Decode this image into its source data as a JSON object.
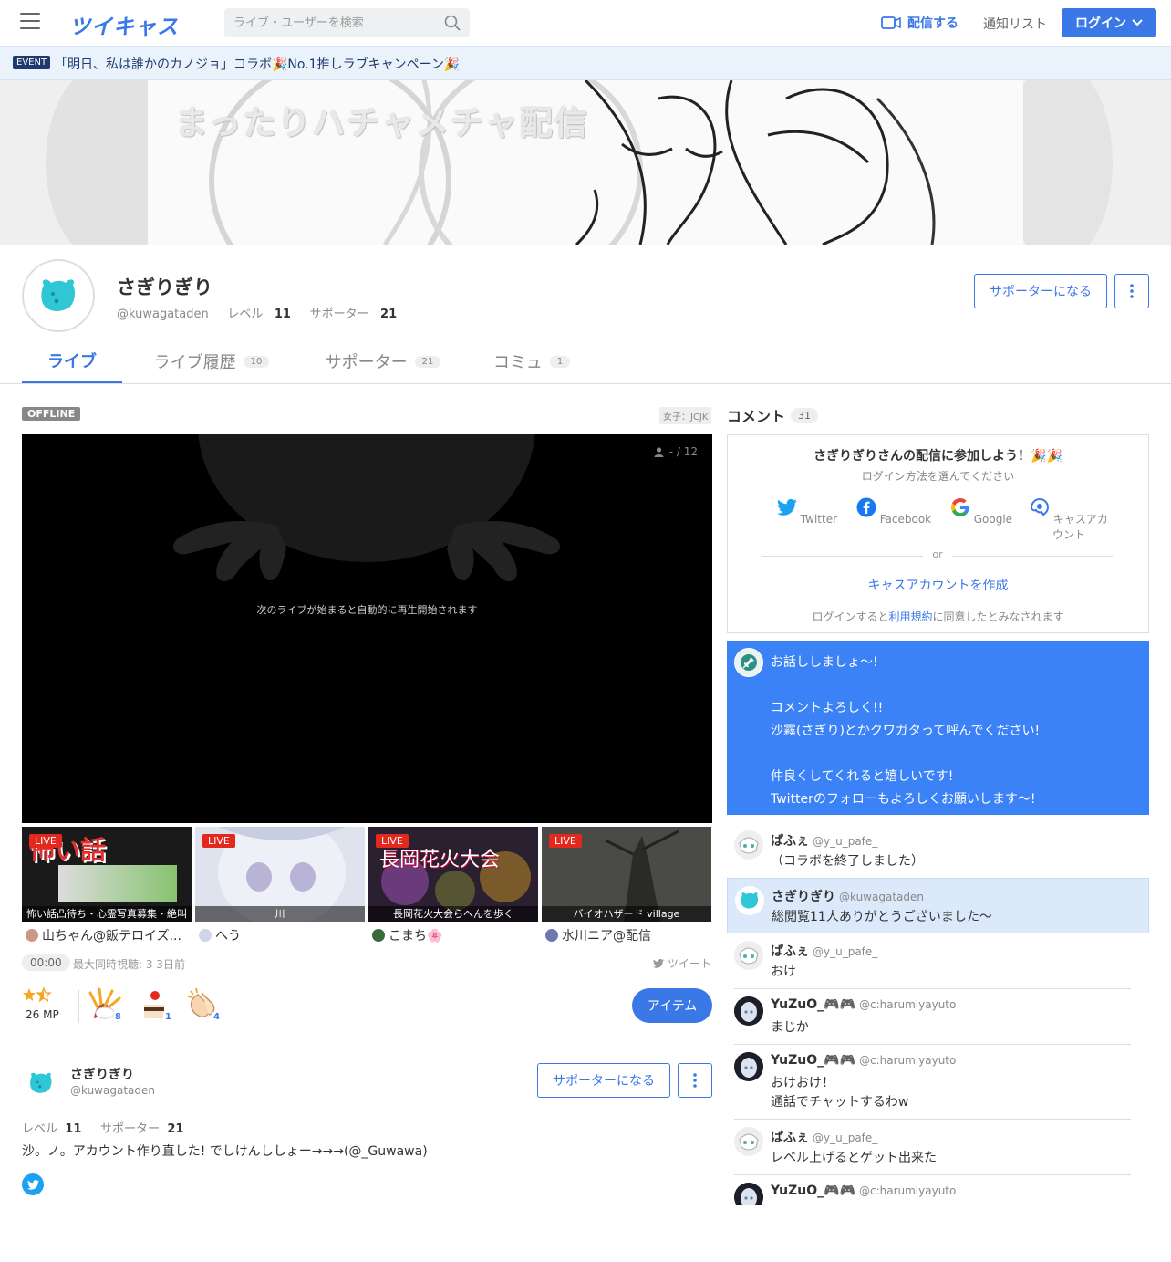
{
  "header": {
    "logo": "ツイキャス",
    "search_placeholder": "ライブ・ユーザーを検索",
    "broadcast_label": "配信する",
    "notify_label": "通知リスト",
    "login_label": "ログイン"
  },
  "event": {
    "badge": "EVENT",
    "text": "「明日、私は誰かのカノジョ」コラボ🎉No.1推しラブキャンペーン🎉"
  },
  "banner": {
    "title": "まったりハチャメチャ配信"
  },
  "profile": {
    "name": "さぎりぎり",
    "handle": "@kuwagataden",
    "level_label": "レベル",
    "level": "11",
    "supporter_label": "サポーター",
    "supporters": "21",
    "supporter_button": "サポーターになる"
  },
  "tabs": [
    {
      "label": "ライブ",
      "count": ""
    },
    {
      "label": "ライブ履歴",
      "count": "10"
    },
    {
      "label": "サポーター",
      "count": "21"
    },
    {
      "label": "コミュ",
      "count": "1"
    }
  ],
  "player": {
    "status": "OFFLINE",
    "category": "女子：JCJK",
    "viewers": "- / 12",
    "message": "次のライブが始まると自動的に再生開始されます"
  },
  "live_thumbs": [
    {
      "badge": "LIVE",
      "caption": "怖い話凸待ち・心霊写真募集・絶叫",
      "title_art": "怖い話",
      "user": "山ちゃん@飯テロイズ...",
      "color": "#1a1a1a"
    },
    {
      "badge": "LIVE",
      "caption": "川",
      "title_art": "",
      "user": "へう",
      "color": "#dfe3ee"
    },
    {
      "badge": "LIVE",
      "caption": "長岡花火大会らへんを歩く",
      "title_art": "長岡花火大会",
      "user": "こまち🌸",
      "color": "#2a2030"
    },
    {
      "badge": "LIVE",
      "caption": "バイオハザード village",
      "title_art": "",
      "user": "水川ニア@配信",
      "color": "#3a3a38"
    }
  ],
  "stats": {
    "duration": "00:00",
    "text": "最大同時視聴: 3  3日前",
    "tweet_label": "ツイート",
    "mp": "26 MP",
    "gifts": [
      {
        "count": "8"
      },
      {
        "count": "1"
      },
      {
        "count": "4"
      }
    ],
    "item_button": "アイテム"
  },
  "bio": {
    "name": "さぎりぎり",
    "handle": "@kuwagataden",
    "level_label": "レベル",
    "level": "11",
    "supporter_label": "サポーター",
    "supporters": "21",
    "supporter_button": "サポーターになる",
    "text": "沙。ノ。アカウント作り直した! でしけんししょー→→→(@_Guwawa)"
  },
  "comments_panel": {
    "title": "コメント",
    "count": "31",
    "login_title": "さぎりぎりさんの配信に参加しよう！🎉🎉",
    "login_sub": "ログイン方法を選んでください",
    "options": [
      "Twitter",
      "Facebook",
      "Google",
      "キャスアカウント"
    ],
    "or": "or",
    "create_account": "キャスアカウントを作成",
    "terms_before": "ログインすると",
    "terms_link": "利用規約",
    "terms_after": "に同意したとみなされます",
    "pinned": "お話ししましょ〜!\n\nコメントよろしく!!\n沙霧(さぎり)とかクワガタって呼んでください!\n\n仲良くしてくれると嬉しいです!\nTwitterのフォローもよろしくお願いします〜!"
  },
  "comments": [
    {
      "name": "ぱふぇ",
      "handle": "@y_u_pafe_",
      "text": "（コラボを終了しました）"
    },
    {
      "name": "さぎりぎり",
      "handle": "@kuwagataden",
      "text": "総閲覧11人ありがとうございました〜"
    },
    {
      "name": "ぱふぇ",
      "handle": "@y_u_pafe_",
      "text": "おけ"
    },
    {
      "name": "YuZuO_🎮🎮",
      "handle": "@c:harumiyayuto",
      "text": "まじか"
    },
    {
      "name": "YuZuO_🎮🎮",
      "handle": "@c:harumiyayuto",
      "text": "おけおけ！\n通話でチャットするわw"
    },
    {
      "name": "ぱふぇ",
      "handle": "@y_u_pafe_",
      "text": "レベル上げるとゲット出来た"
    },
    {
      "name": "YuZuO_🎮🎮",
      "handle": "@c:harumiyayuto",
      "text": ""
    }
  ],
  "colors": {
    "accent": "#3b78e7",
    "live": "#e3281e",
    "pinned": "#3b82f6"
  }
}
